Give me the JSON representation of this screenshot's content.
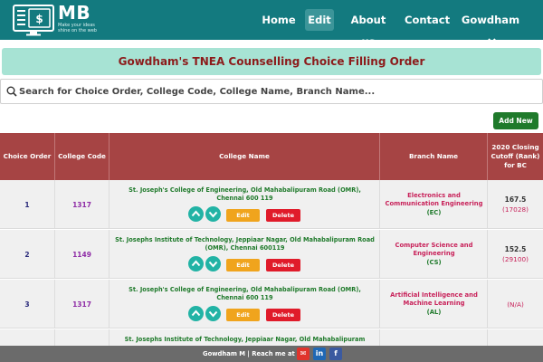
{
  "brand": {
    "name": "MB",
    "tagline": "Make your ideas shine on the web"
  },
  "nav": {
    "home": "Home",
    "edit": "Edit",
    "about": "About us",
    "contact": "Contact",
    "user": "Gowdham"
  },
  "page_title": "Gowdham's TNEA Counselling Choice Filling Order",
  "search": {
    "placeholder": "Search for Choice Order, College Code, College Name, Branch Name..."
  },
  "add_new_label": "Add New",
  "table": {
    "headers": {
      "order": "Choice Order",
      "code": "College Code",
      "college": "College Name",
      "branch": "Branch Name",
      "cutoff": "2020 Closing Cutoff (Rank) for BC"
    },
    "edit_label": "Edit",
    "delete_label": "Delete",
    "rows": [
      {
        "order": "1",
        "code": "1317",
        "college": "St. Joseph's College of Engineering, Old Mahabalipuram Road (OMR), Chennai 600 119",
        "branch": "Electronics and Communication Engineering",
        "branch_code": "(EC)",
        "cutoff": "167.5",
        "rank": "(17028)"
      },
      {
        "order": "2",
        "code": "1149",
        "college": "St. Josephs Institute of Technology, Jeppiaar Nagar, Old Mahabalipuram Road (OMR), Chennai 600119",
        "branch": "Computer Science and Engineering",
        "branch_code": "(CS)",
        "cutoff": "152.5",
        "rank": "(29100)"
      },
      {
        "order": "3",
        "code": "1317",
        "college": "St. Joseph's College of Engineering, Old Mahabalipuram Road (OMR), Chennai 600 119",
        "branch": "Artificial Intelligence and Machine Learning",
        "branch_code": "(AL)",
        "cutoff": "",
        "rank": "(N/A)"
      },
      {
        "order": "",
        "code": "",
        "college": "St. Josephs Institute of Technology, Jeppiaar Nagar, Old Mahabalipuram",
        "branch": "",
        "branch_code": "",
        "cutoff": "",
        "rank": ""
      }
    ]
  },
  "footer": {
    "text": "Gowdham M | Reach me at",
    "mail": "✉",
    "linkedin": "in",
    "facebook": "f"
  },
  "colors": {
    "navbar": "#137a7f",
    "banner": "#a7e3d4",
    "title": "#8c1b1b",
    "table_header": "#a64444",
    "add_new": "#1f7a2b",
    "edit": "#f0a41d",
    "delete": "#e01b2a",
    "arrow": "#22b3a5"
  },
  "icons": {
    "logo": "monitor-dollar-icon",
    "caret": "chevron-down-icon",
    "search": "search-icon",
    "up": "chevron-up-icon",
    "down": "chevron-down-icon"
  }
}
